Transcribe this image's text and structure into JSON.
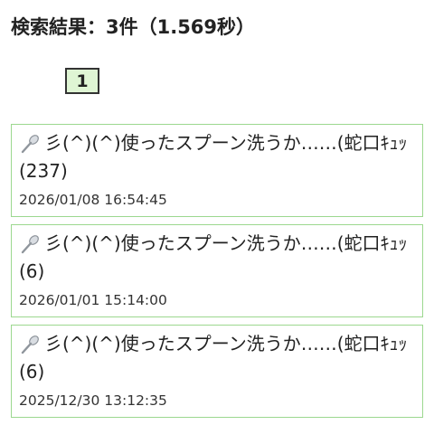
{
  "search": {
    "summary": "検索結果：3件（1.569秒）"
  },
  "pagination": {
    "pages": [
      "1"
    ],
    "current": "1"
  },
  "results": [
    {
      "icon": "spoon-icon",
      "title": "彡(^)(^)使ったスプーン洗うか……(蛇口ｷｭｯ",
      "count": "(237)",
      "date": "2026/01/08 16:54:45"
    },
    {
      "icon": "spoon-icon",
      "title": "彡(^)(^)使ったスプーン洗うか……(蛇口ｷｭｯ",
      "count": "(6)",
      "date": "2026/01/01 15:14:00"
    },
    {
      "icon": "spoon-icon",
      "title": "彡(^)(^)使ったスプーン洗うか……(蛇口ｷｭｯ",
      "count": "(6)",
      "date": "2025/12/30 13:12:35"
    }
  ],
  "colors": {
    "card_border": "#9cd88f",
    "page_active_bg": "#dff5d4"
  }
}
